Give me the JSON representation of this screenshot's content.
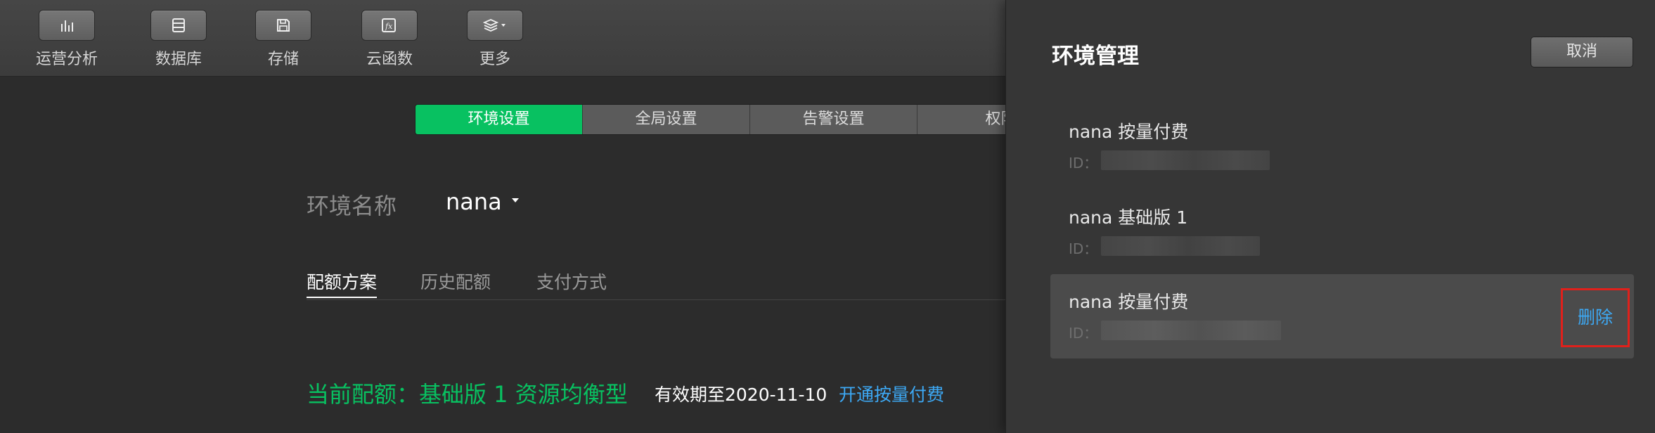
{
  "toolbar": {
    "items": [
      {
        "label": "运营分析",
        "icon": "bar-chart-icon"
      },
      {
        "label": "数据库",
        "icon": "database-icon"
      },
      {
        "label": "存储",
        "icon": "storage-icon"
      },
      {
        "label": "云函数",
        "icon": "function-icon"
      },
      {
        "label": "更多",
        "icon": "layers-icon"
      }
    ]
  },
  "settings_tabs": [
    "环境设置",
    "全局设置",
    "告警设置",
    "权限"
  ],
  "env": {
    "label": "环境名称",
    "selected": "nana"
  },
  "sub_tabs": [
    "配额方案",
    "历史配额",
    "支付方式"
  ],
  "quota": {
    "current": "当前配额：基础版 1 资源均衡型",
    "expire": "有效期至2020-11-10",
    "upgrade_link": "开通按量付费"
  },
  "panel": {
    "title": "环境管理",
    "cancel": "取消",
    "id_prefix": "ID：",
    "delete": "删除",
    "environments": [
      {
        "name": "nana 按量付费"
      },
      {
        "name": "nana 基础版 1"
      },
      {
        "name": "nana 按量付费"
      }
    ]
  },
  "colors": {
    "accent_green": "#08c161",
    "link_blue": "#3da9f5",
    "highlight_red": "#e0201b"
  }
}
